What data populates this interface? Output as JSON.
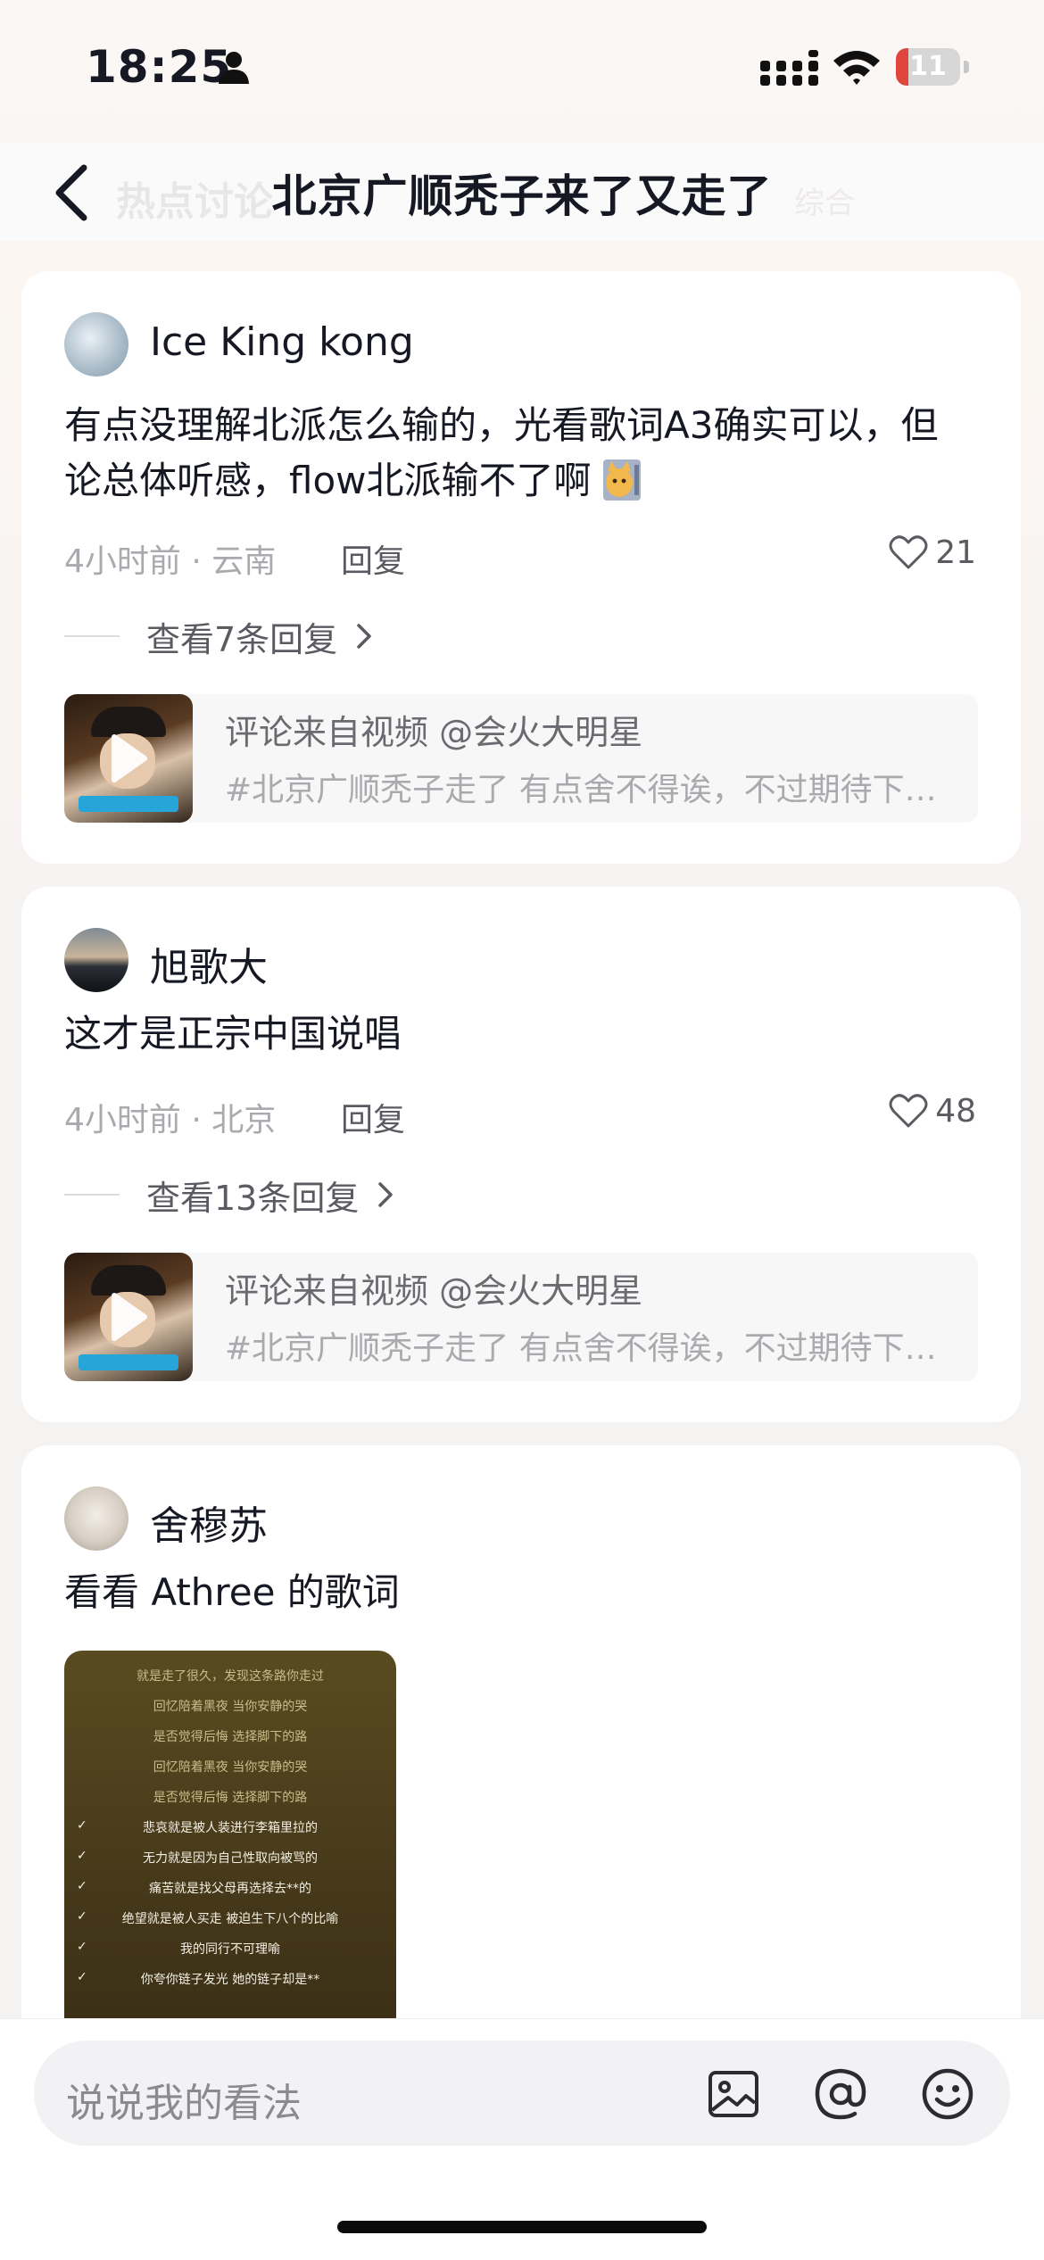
{
  "status_bar": {
    "time": "18:25",
    "battery": "11",
    "battery_level": 0.11
  },
  "nav": {
    "title": "北京广顺秃子来了又走了",
    "ghost_tab": "热点讨论",
    "ghost_right": "综合"
  },
  "comments": [
    {
      "username": "Ice King kong",
      "text": "有点没理解北派怎么输的，光看歌词A3确实可以，但论总体听感，flow北派输不了啊",
      "meta": "4小时前 · 云南",
      "reply_label": "回复",
      "likes": "21",
      "view_replies": "查看7条回复",
      "video_source": {
        "label": "评论来自视频 @会火大明星",
        "desc": "#北京广顺秃子走了  有点舍不得诶，不过期待下一期的精彩表演"
      }
    },
    {
      "username": "旭歌大",
      "text": "这才是正宗中国说唱",
      "meta": "4小时前 · 北京",
      "reply_label": "回复",
      "likes": "48",
      "view_replies": "查看13条回复",
      "video_source": {
        "label": "评论来自视频 @会火大明星",
        "desc": "#北京广顺秃子走了  有点舍不得诶，不过期待下一期的精彩表演"
      }
    },
    {
      "username": "舍穆苏",
      "text": "看看 Athree 的歌词",
      "lyrics": [
        "就是走了很久，发现这条路你走过",
        "回忆陪着黑夜 当你安静的哭",
        "是否觉得后悔 选择脚下的路",
        "回忆陪着黑夜 当你安静的哭",
        "是否觉得后悔 选择脚下的路",
        "悲哀就是被人装进行李箱里拉的",
        "无力就是因为自己性取向被骂的",
        "痛苦就是找父母再选择去**的",
        "绝望就是被人买走 被迫生下八个的比喻",
        "我的同行不可理喻",
        "你夸你链子发光 她的链子却是**"
      ]
    }
  ],
  "input": {
    "placeholder": "说说我的看法"
  },
  "icons": [
    "person-icon",
    "signal-icon",
    "wifi-icon",
    "back-icon",
    "heart-icon",
    "chevron-right-icon",
    "play-icon",
    "image-icon",
    "at-icon",
    "emoji-icon"
  ],
  "colors": {
    "text": "#161823",
    "secondary": "#a9aaae",
    "battery_low": "#e0463e"
  }
}
